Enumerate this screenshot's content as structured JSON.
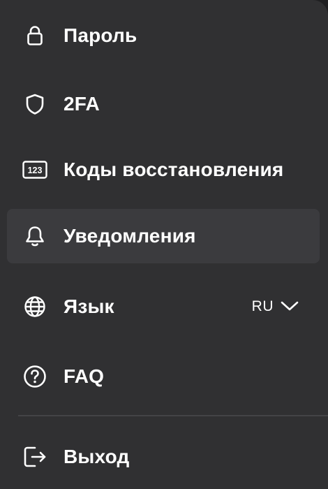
{
  "menu": {
    "items": [
      {
        "id": "password",
        "label": "Пароль",
        "icon": "lock-icon",
        "active": false
      },
      {
        "id": "2fa",
        "label": "2FA",
        "icon": "shield-icon",
        "active": false
      },
      {
        "id": "recovery-codes",
        "label": "Коды восстановления",
        "icon": "recovery-codes-icon",
        "active": false
      },
      {
        "id": "notifications",
        "label": "Уведомления",
        "icon": "bell-icon",
        "active": true
      },
      {
        "id": "language",
        "label": "Язык",
        "icon": "globe-icon",
        "active": false
      },
      {
        "id": "faq",
        "label": "FAQ",
        "icon": "question-circle-icon",
        "active": false
      },
      {
        "id": "logout",
        "label": "Выход",
        "icon": "logout-icon",
        "active": false
      }
    ],
    "recovery_codes_icon_text": "123",
    "language": {
      "selected": "RU",
      "dropdown_icon": "chevron-down-icon"
    }
  },
  "colors": {
    "menu_background": "#303032",
    "active_row": "#3b3b3e",
    "text": "#ffffff",
    "divider": "#434346"
  }
}
